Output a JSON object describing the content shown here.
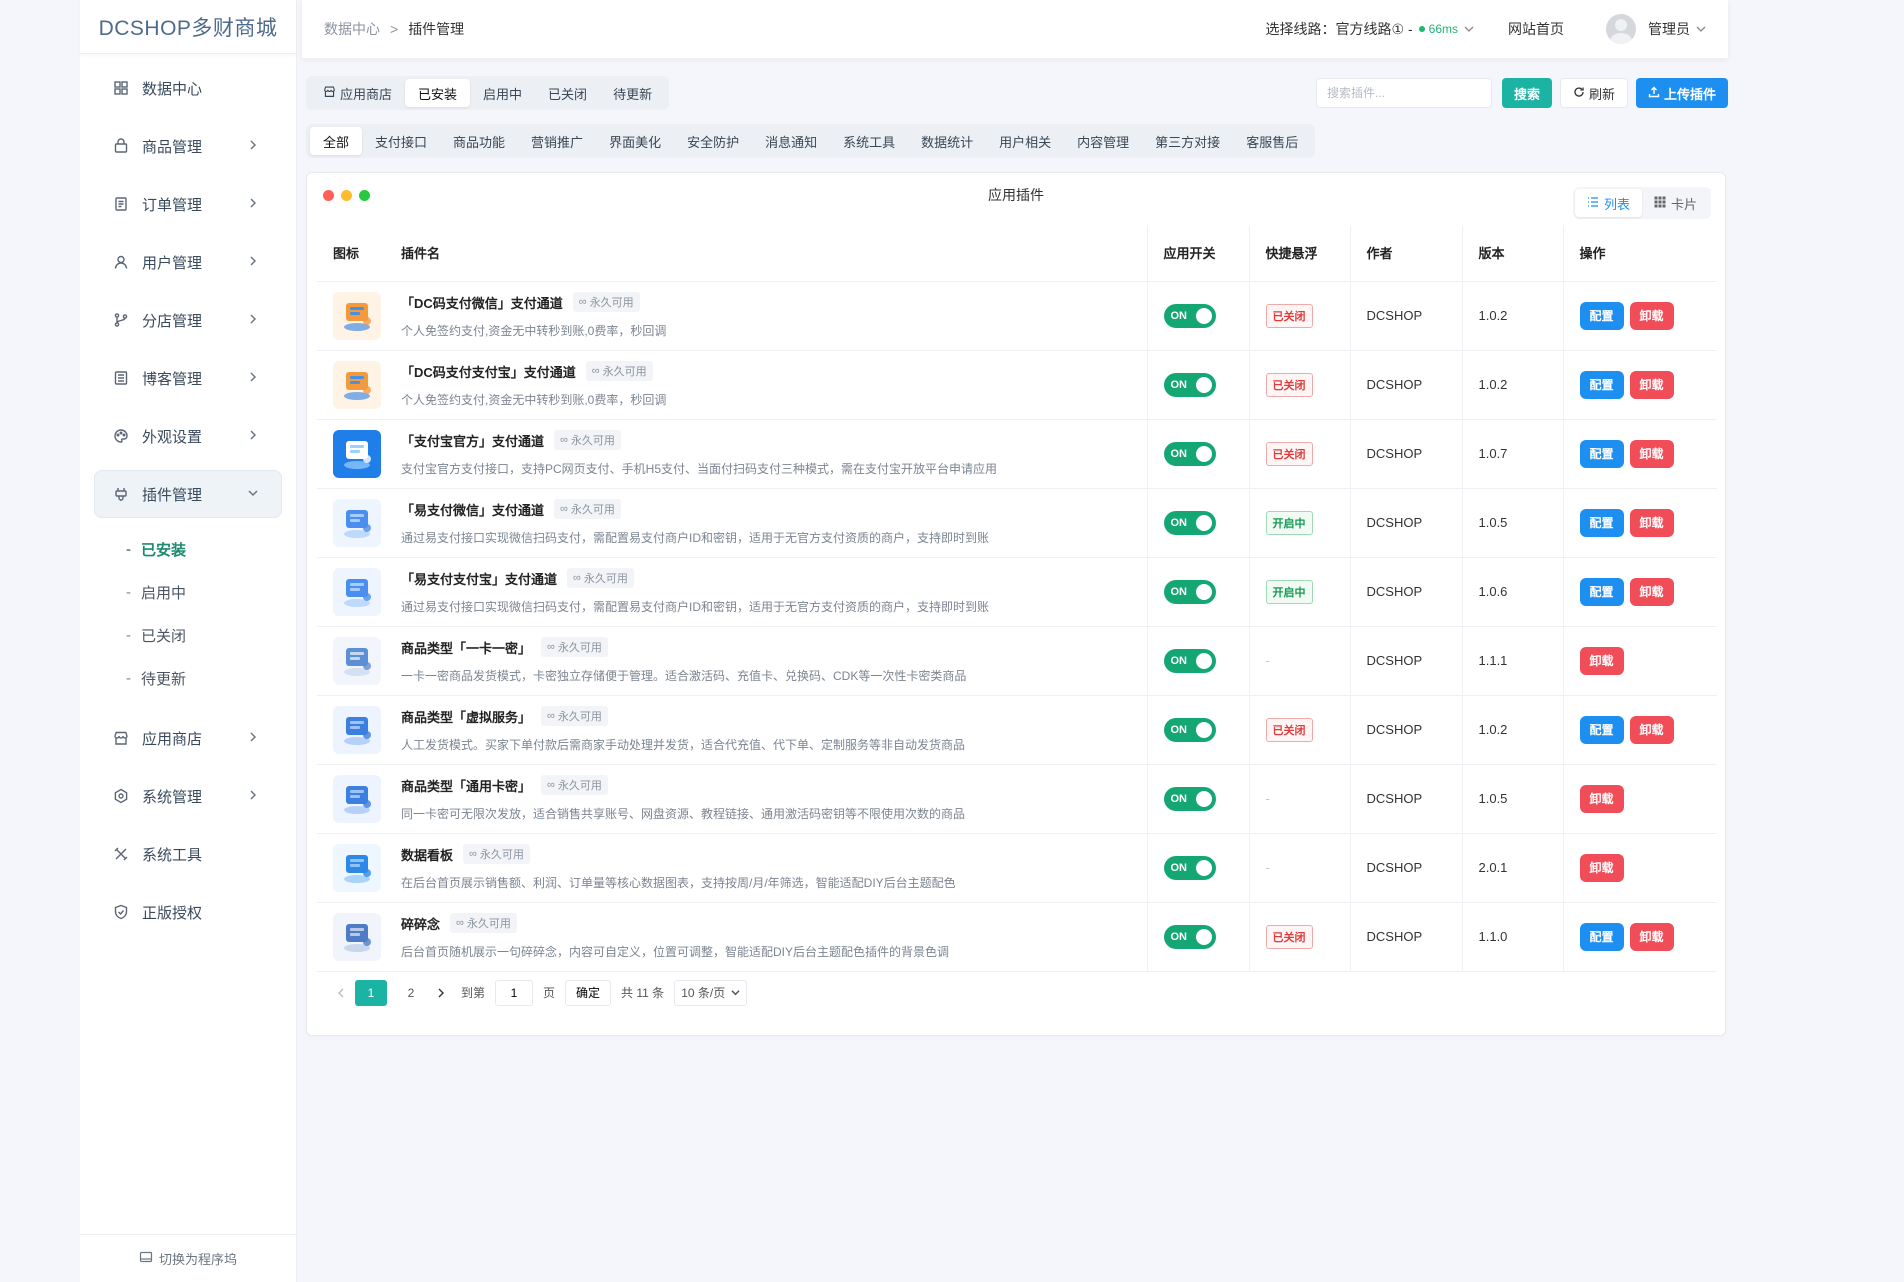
{
  "brand": "DCSHOP多财商城",
  "sidebar": {
    "items": [
      {
        "label": "数据中心",
        "icon": "dashboard-icon"
      },
      {
        "label": "商品管理",
        "icon": "bag-icon"
      },
      {
        "label": "订单管理",
        "icon": "order-icon"
      },
      {
        "label": "用户管理",
        "icon": "user-icon"
      },
      {
        "label": "分店管理",
        "icon": "branch-icon"
      },
      {
        "label": "博客管理",
        "icon": "blog-icon"
      },
      {
        "label": "外观设置",
        "icon": "palette-icon"
      },
      {
        "label": "插件管理",
        "icon": "plugin-icon"
      },
      {
        "label": "应用商店",
        "icon": "store-icon"
      },
      {
        "label": "系统管理",
        "icon": "settings-icon"
      },
      {
        "label": "系统工具",
        "icon": "tools-icon"
      },
      {
        "label": "正版授权",
        "icon": "shield-icon"
      }
    ],
    "sub": [
      "已安装",
      "启用中",
      "已关闭",
      "待更新"
    ],
    "footer": "切换为程序坞"
  },
  "header": {
    "crumb_root": "数据中心",
    "crumb_sep": ">",
    "crumb_current": "插件管理",
    "line_label": "选择线路：官方线路①  -",
    "latency": "66ms",
    "home": "网站首页",
    "user": "管理员"
  },
  "tabs": [
    "应用商店",
    "已安装",
    "启用中",
    "已关闭",
    "待更新"
  ],
  "search": {
    "placeholder": "搜索插件...",
    "button": "搜索"
  },
  "refresh": "刷新",
  "upload": "上传插件",
  "categories": [
    "全部",
    "支付接口",
    "商品功能",
    "营销推广",
    "界面美化",
    "安全防护",
    "消息通知",
    "系统工具",
    "数据统计",
    "用户相关",
    "内容管理",
    "第三方对接",
    "客服售后"
  ],
  "panel": {
    "title": "应用插件",
    "view_list": "列表",
    "view_card": "卡片"
  },
  "table": {
    "headers": [
      "图标",
      "插件名",
      "应用开关",
      "快捷悬浮",
      "作者",
      "版本",
      "操作"
    ],
    "permanent": "永久可用",
    "switch_on": "ON",
    "config": "配置",
    "uninstall": "卸载",
    "rows": [
      {
        "name": "「DC码支付微信」支付通道",
        "desc": "个人免签约支付,资金无中转秒到账,0费率，秒回调",
        "float": "已关闭",
        "float_state": "off",
        "author": "DCSHOP",
        "version": "1.0.2",
        "config": true
      },
      {
        "name": "「DC码支付支付宝」支付通道",
        "desc": "个人免签约支付,资金无中转秒到账,0费率，秒回调",
        "float": "已关闭",
        "float_state": "off",
        "author": "DCSHOP",
        "version": "1.0.2",
        "config": true
      },
      {
        "name": "「支付宝官方」支付通道",
        "desc": "支付宝官方支付接口，支持PC网页支付、手机H5支付、当面付扫码支付三种模式，需在支付宝开放平台申请应用",
        "float": "已关闭",
        "float_state": "off",
        "author": "DCSHOP",
        "version": "1.0.7",
        "config": true
      },
      {
        "name": "「易支付微信」支付通道",
        "desc": "通过易支付接口实现微信扫码支付，需配置易支付商户ID和密钥，适用于无官方支付资质的商户，支持即时到账",
        "float": "开启中",
        "float_state": "on",
        "author": "DCSHOP",
        "version": "1.0.5",
        "config": true
      },
      {
        "name": "「易支付支付宝」支付通道",
        "desc": "通过易支付接口实现微信扫码支付，需配置易支付商户ID和密钥，适用于无官方支付资质的商户，支持即时到账",
        "float": "开启中",
        "float_state": "on",
        "author": "DCSHOP",
        "version": "1.0.6",
        "config": true
      },
      {
        "name": "商品类型「一卡一密」",
        "desc": "一卡一密商品发货模式，卡密独立存储便于管理。适合激活码、充值卡、兑换码、CDK等一次性卡密类商品",
        "float": "-",
        "float_state": "none",
        "author": "DCSHOP",
        "version": "1.1.1",
        "config": false
      },
      {
        "name": "商品类型「虚拟服务」",
        "desc": "人工发货模式。买家下单付款后需商家手动处理并发货，适合代充值、代下单、定制服务等非自动发货商品",
        "float": "已关闭",
        "float_state": "off",
        "author": "DCSHOP",
        "version": "1.0.2",
        "config": true
      },
      {
        "name": "商品类型「通用卡密」",
        "desc": "同一卡密可无限次发放，适合销售共享账号、网盘资源、教程链接、通用激活码密钥等不限使用次数的商品",
        "float": "-",
        "float_state": "none",
        "author": "DCSHOP",
        "version": "1.0.5",
        "config": false
      },
      {
        "name": "数据看板",
        "desc": "在后台首页展示销售额、利润、订单量等核心数据图表，支持按周/月/年筛选，智能适配DIY后台主题配色",
        "float": "-",
        "float_state": "none",
        "author": "DCSHOP",
        "version": "2.0.1",
        "config": false
      },
      {
        "name": "碎碎念",
        "desc": "后台首页随机展示一句碎碎念，内容可自定义，位置可调整，智能适配DIY后台主题配色插件的背景色调",
        "float": "已关闭",
        "float_state": "off",
        "author": "DCSHOP",
        "version": "1.1.0",
        "config": true
      }
    ]
  },
  "pagination": {
    "pages": [
      "1",
      "2"
    ],
    "goto_label": "到第",
    "goto_value": "1",
    "page_unit": "页",
    "confirm": "确定",
    "total": "共 11 条",
    "page_size": "10 条/页"
  },
  "colors": {
    "accent": "#1bb3a3",
    "primary": "#1c8ff0",
    "danger": "#f04d58",
    "switch_on": "#14a774"
  }
}
